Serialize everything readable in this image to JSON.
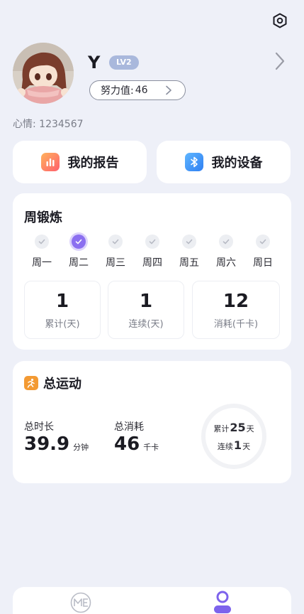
{
  "profile": {
    "name": "Y",
    "level": "LV2",
    "effort_label": "努力值:",
    "effort_value": "46",
    "mood_label": "心情:",
    "mood_value": "1234567"
  },
  "shortcuts": {
    "report": "我的报告",
    "device": "我的设备"
  },
  "weekly": {
    "title": "周锻炼",
    "days": [
      {
        "label": "周一",
        "checked": false
      },
      {
        "label": "周二",
        "checked": true
      },
      {
        "label": "周三",
        "checked": false
      },
      {
        "label": "周四",
        "checked": false
      },
      {
        "label": "周五",
        "checked": false
      },
      {
        "label": "周六",
        "checked": false
      },
      {
        "label": "周日",
        "checked": false
      }
    ],
    "stats": [
      {
        "value": "1",
        "label": "累计(天)"
      },
      {
        "value": "1",
        "label": "连续(天)"
      },
      {
        "value": "12",
        "label": "消耗(千卡)"
      }
    ]
  },
  "total": {
    "title": "总运动",
    "duration_label": "总时长",
    "duration_value": "39.9",
    "duration_unit": "分钟",
    "calories_label": "总消耗",
    "calories_value": "46",
    "calories_unit": "千卡",
    "ring_total_prefix": "累计",
    "ring_total_value": "25",
    "ring_total_unit": "天",
    "ring_streak_prefix": "连续",
    "ring_streak_value": "1",
    "ring_streak_unit": "天"
  },
  "tabs": {
    "home_icon": "me-logo-icon",
    "profile_icon": "person-icon",
    "active": "profile"
  },
  "colors": {
    "accent": "#8b6ff0",
    "background": "#eef0f8",
    "level_badge": "#a9b8dc",
    "run_icon": "#f39a33"
  }
}
